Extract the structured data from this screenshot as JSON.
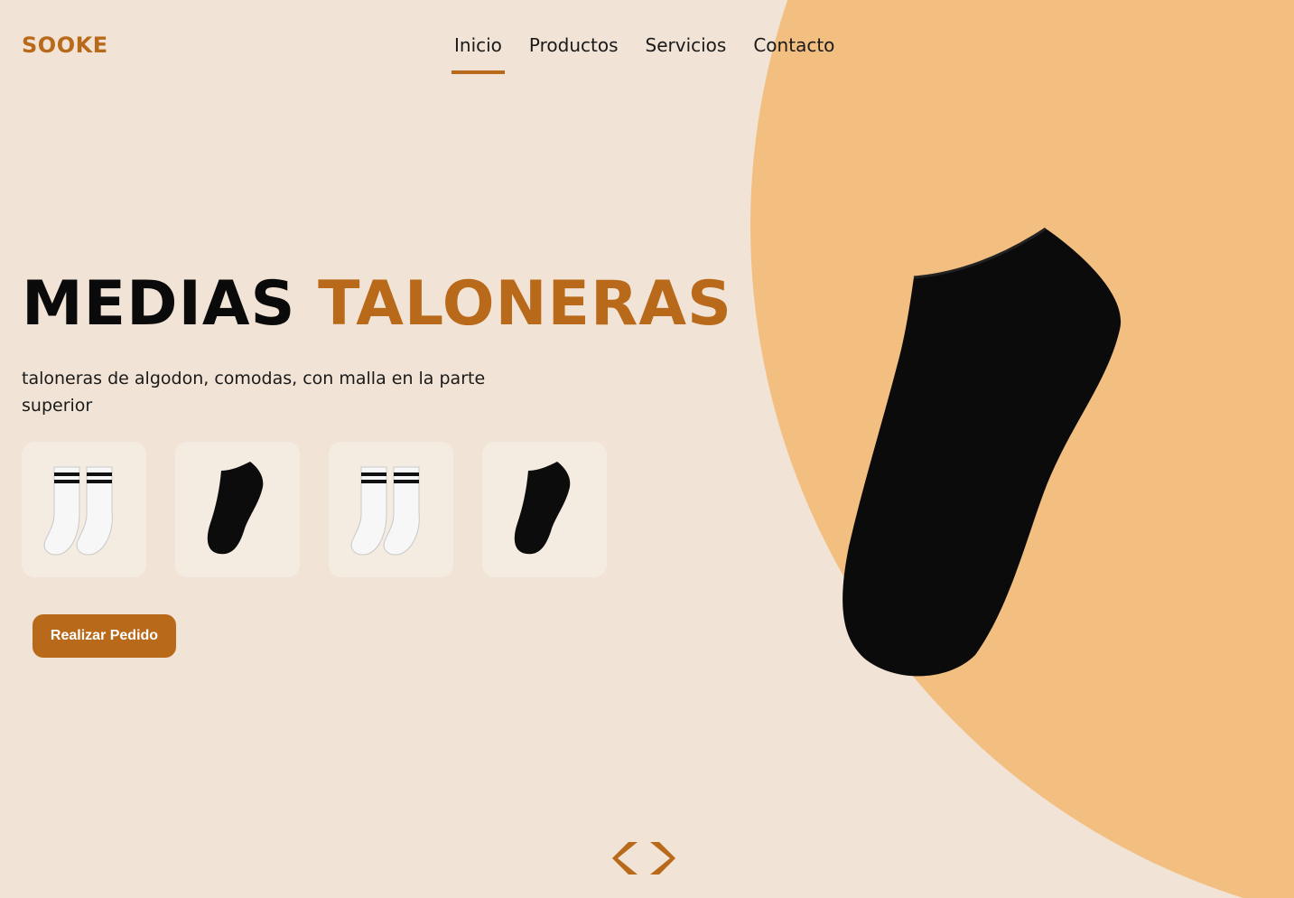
{
  "brand": {
    "logo": "SOOKE",
    "accent_color": "#b8691a",
    "circle_color": "#f3bf81",
    "background_color": "#f1e3d5"
  },
  "nav": {
    "items": [
      {
        "label": "Inicio",
        "active": true
      },
      {
        "label": "Productos",
        "active": false
      },
      {
        "label": "Servicios",
        "active": false
      },
      {
        "label": "Contacto",
        "active": false
      }
    ]
  },
  "hero": {
    "title_part1": "MEDIAS",
    "title_part2": "TALONERAS",
    "description": "taloneras de algodon, comodas, con malla en la parte superior",
    "cta_label": "Realizar Pedido",
    "image_icon": "black-ankle-sock-icon"
  },
  "thumbnails": [
    {
      "icon": "white-striped-socks-icon"
    },
    {
      "icon": "black-ankle-sock-icon"
    },
    {
      "icon": "white-striped-socks-icon"
    },
    {
      "icon": "black-ankle-sock-icon"
    }
  ],
  "carousel": {
    "prev_icon": "chevron-left-icon",
    "next_icon": "chevron-right-icon"
  }
}
